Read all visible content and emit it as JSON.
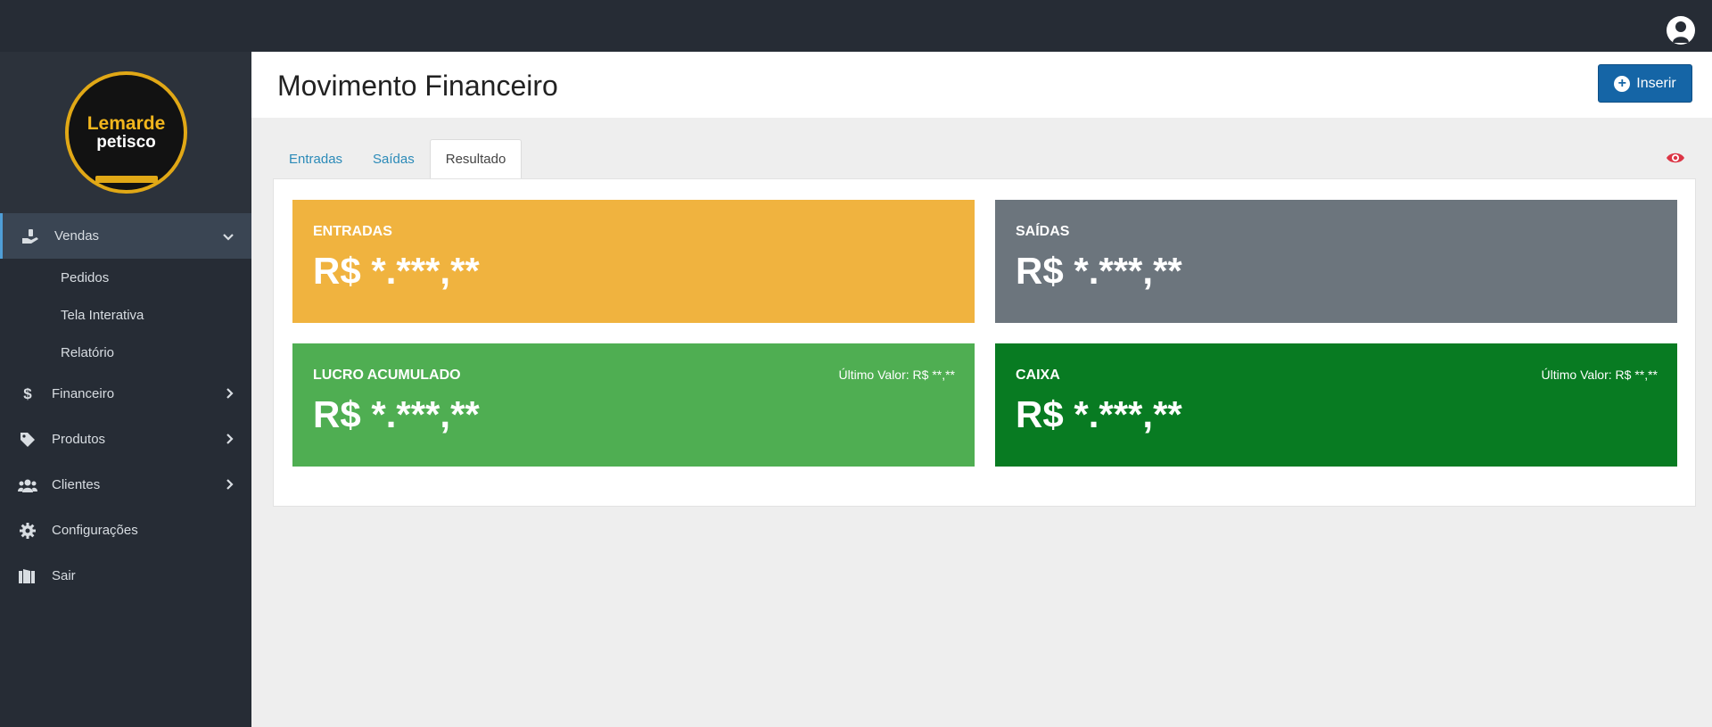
{
  "colors": {
    "topbar": "#262c35",
    "sidebar": "#262c35",
    "accent": "#1565a6",
    "entradas": "#f0b33f",
    "saidas": "#6c757d",
    "lucro": "#4fae52",
    "caixa": "#087b22",
    "eye": "#dc3545"
  },
  "logo": {
    "line1": "Lemarde",
    "line2": "petisco"
  },
  "sidebar": {
    "items": [
      {
        "label": "Vendas",
        "icon": "hand-holding-icon",
        "expanded": true,
        "subitems": [
          {
            "label": "Pedidos"
          },
          {
            "label": "Tela Interativa"
          },
          {
            "label": "Relatório"
          }
        ]
      },
      {
        "label": "Financeiro",
        "icon": "dollar-icon"
      },
      {
        "label": "Produtos",
        "icon": "tag-icon"
      },
      {
        "label": "Clientes",
        "icon": "users-icon"
      },
      {
        "label": "Configurações",
        "icon": "gear-icon"
      },
      {
        "label": "Sair",
        "icon": "door-exit-icon"
      }
    ]
  },
  "header": {
    "title": "Movimento Financeiro",
    "insert_label": "Inserir"
  },
  "tabs": [
    {
      "label": "Entradas"
    },
    {
      "label": "Saídas"
    },
    {
      "label": "Resultado",
      "active": true
    }
  ],
  "cards": {
    "entradas": {
      "label": "ENTRADAS",
      "value": "R$ *.***,**"
    },
    "saidas": {
      "label": "SAÍDAS",
      "value": "R$ *.***,**"
    },
    "lucro": {
      "label": "LUCRO ACUMULADO",
      "value": "R$ *.***,**",
      "last_value": "Último Valor: R$ **,**"
    },
    "caixa": {
      "label": "CAIXA",
      "value": "R$ *.***,**",
      "last_value": "Último Valor: R$ **,**"
    }
  }
}
